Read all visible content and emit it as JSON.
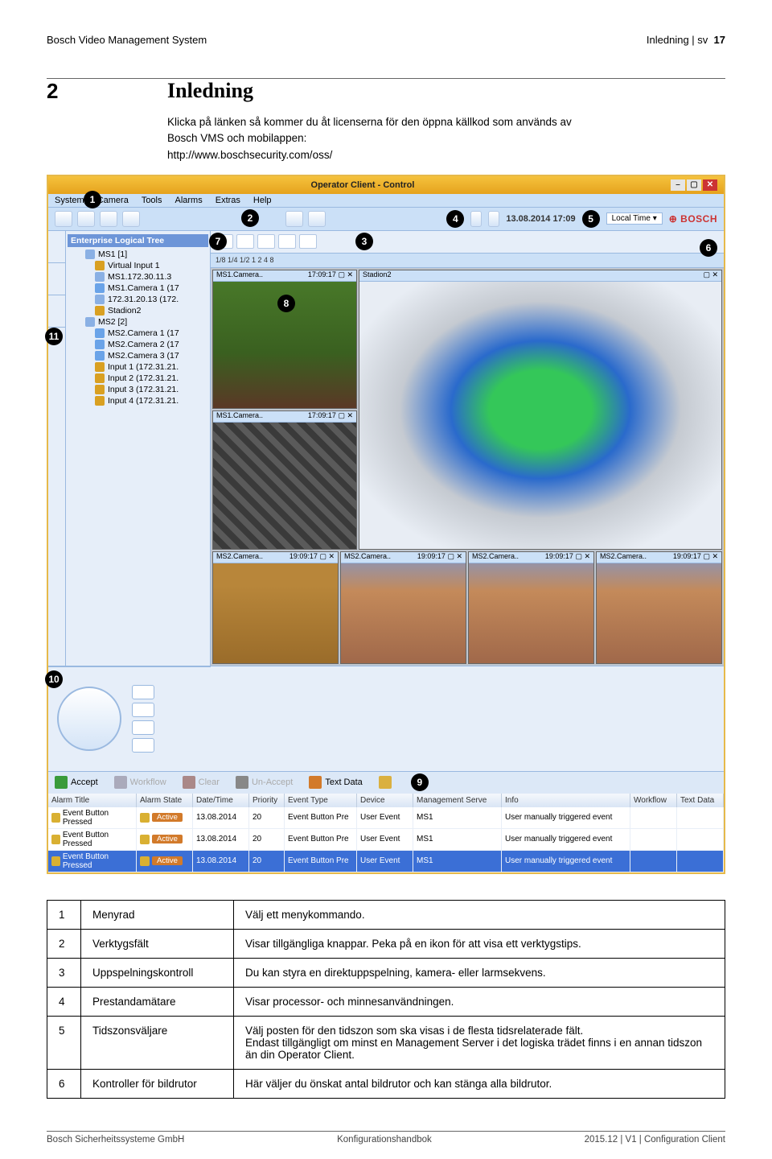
{
  "header": {
    "left": "Bosch Video Management System",
    "right": "Inledning | sv",
    "pageNum": "17"
  },
  "section": {
    "number": "2",
    "title": "Inledning"
  },
  "intro": {
    "line1": "Klicka på länken så kommer du åt licenserna för den öppna källkod som används av",
    "line2": "Bosch VMS och mobilappen:",
    "link": "http://www.boschsecurity.com/oss/"
  },
  "app": {
    "titlebar": "Operator Client - Control",
    "menu": [
      "System",
      "Camera",
      "Tools",
      "Alarms",
      "Extras",
      "Help"
    ],
    "timestamp": "13.08.2014 17:09",
    "localTime": "Local Time",
    "brand": "BOSCH",
    "treeRoot": "Enterprise Logical Tree",
    "tree": [
      {
        "lvl": 2,
        "t": "MS1 [1]",
        "ic": "srv"
      },
      {
        "lvl": 3,
        "t": "Virtual Input 1",
        "ic": "inp"
      },
      {
        "lvl": 3,
        "t": "MS1.172.30.11.3",
        "ic": "srv"
      },
      {
        "lvl": 3,
        "t": "MS1.Camera 1 (17",
        "ic": "cam"
      },
      {
        "lvl": 3,
        "t": "172.31.20.13 (172.",
        "ic": "srv"
      },
      {
        "lvl": 3,
        "t": "Stadion2",
        "ic": "inp"
      },
      {
        "lvl": 2,
        "t": "MS2 [2]",
        "ic": "srv"
      },
      {
        "lvl": 3,
        "t": "MS2.Camera 1 (17",
        "ic": "cam"
      },
      {
        "lvl": 3,
        "t": "MS2.Camera 2 (17",
        "ic": "cam"
      },
      {
        "lvl": 3,
        "t": "MS2.Camera 3 (17",
        "ic": "cam"
      },
      {
        "lvl": 3,
        "t": "Input 1 (172.31.21.",
        "ic": "inp"
      },
      {
        "lvl": 3,
        "t": "Input 2 (172.31.21.",
        "ic": "inp"
      },
      {
        "lvl": 3,
        "t": "Input 3 (172.31.21.",
        "ic": "inp"
      },
      {
        "lvl": 3,
        "t": "Input 4 (172.31.21.",
        "ic": "inp"
      }
    ],
    "segRow": "1/8 1/4 1/2  1  2  4  8",
    "panes": {
      "p1": {
        "t": "MS1.Camera..",
        "ts": "17:09:17 ▢ ✕"
      },
      "p2": {
        "t": "Stadion2",
        "ts": "▢ ✕"
      },
      "p3": {
        "t": "MS1.Camera..",
        "ts": "17:09:17 ▢ ✕"
      },
      "p4": {
        "t": "MS2.Camera..",
        "ts": "19:09:17 ▢ ✕"
      },
      "p5": {
        "t": "MS2.Camera..",
        "ts": "19:09:17 ▢ ✕"
      },
      "p6": {
        "t": "MS2.Camera..",
        "ts": "19:09:17 ▢ ✕"
      }
    },
    "alarmBar": {
      "accept": "Accept",
      "workflow": "Workflow",
      "clear": "Clear",
      "unaccept": "Un-Accept",
      "textdata": "Text Data"
    },
    "alarmHdr": [
      "Alarm Title",
      "Alarm State",
      "Date/Time",
      "Priority",
      "Event Type",
      "Device",
      "Management Serve",
      "Info",
      "Workflow",
      "Text Data"
    ],
    "alarmRows": [
      {
        "title": "Event Button Pressed",
        "state": "Active",
        "dt": "13.08.2014",
        "pr": "20",
        "et": "Event Button Pre",
        "dev": "User Event",
        "ms": "MS1",
        "info": "User manually triggered event"
      },
      {
        "title": "Event Button Pressed",
        "state": "Active",
        "dt": "13.08.2014",
        "pr": "20",
        "et": "Event Button Pre",
        "dev": "User Event",
        "ms": "MS1",
        "info": "User manually triggered event"
      },
      {
        "title": "Event Button Pressed",
        "state": "Active",
        "dt": "13.08.2014",
        "pr": "20",
        "et": "Event Button Pre",
        "dev": "User Event",
        "ms": "MS1",
        "info": "User manually triggered event"
      }
    ]
  },
  "legend": [
    {
      "n": "1",
      "name": "Menyrad",
      "desc": "Välj ett menykommando."
    },
    {
      "n": "2",
      "name": "Verktygsfält",
      "desc": "Visar tillgängliga knappar. Peka på en ikon för att visa ett verktygstips."
    },
    {
      "n": "3",
      "name": "Uppspelningskontroll",
      "desc": "Du kan styra en direktuppspelning, kamera- eller larmsekvens."
    },
    {
      "n": "4",
      "name": "Prestandamätare",
      "desc": "Visar processor- och minnesanvändningen."
    },
    {
      "n": "5",
      "name": "Tidszonsväljare",
      "desc": "Välj posten för den tidszon som ska visas i de flesta tidsrelaterade fält.\nEndast tillgängligt om minst en Management Server i det logiska trädet finns i en annan tidszon än din Operator Client."
    },
    {
      "n": "6",
      "name": "Kontroller för bildrutor",
      "desc": "Här väljer du önskat antal bildrutor och kan stänga alla bildrutor."
    }
  ],
  "footer": {
    "left": "Bosch Sicherheitssysteme GmbH",
    "center": "Konfigurationshandbok",
    "right": "2015.12 | V1 | Configuration Client"
  }
}
